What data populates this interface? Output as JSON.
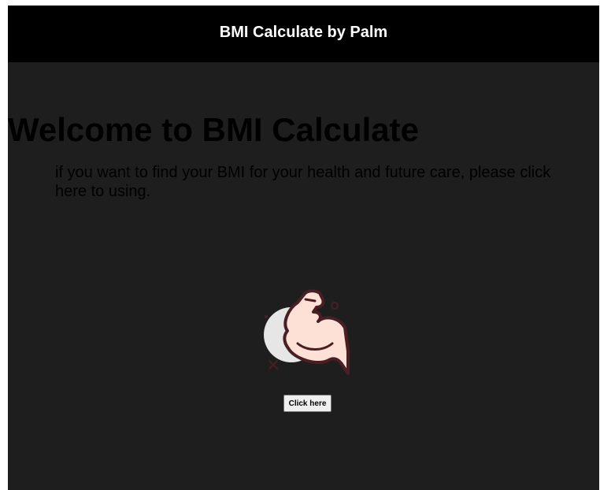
{
  "header": {
    "title": "BMI Calculate by Palm"
  },
  "hero": {
    "title": "Welcome to BMI Calculate",
    "subtitle": "if you want to find your BMI for your health and future care, please click here to using."
  },
  "illustration": {
    "icon": "flexed-bicep-icon"
  },
  "cta": {
    "label": "Click here"
  },
  "colors": {
    "header_bg": "#000000",
    "page_bg": "#1e1e1e",
    "text": "#ffffff",
    "button_bg": "#f0f0f0",
    "arm_skin": "#fde0d6",
    "arm_outline": "#4a1f24",
    "circle": "#e6e6e6"
  }
}
